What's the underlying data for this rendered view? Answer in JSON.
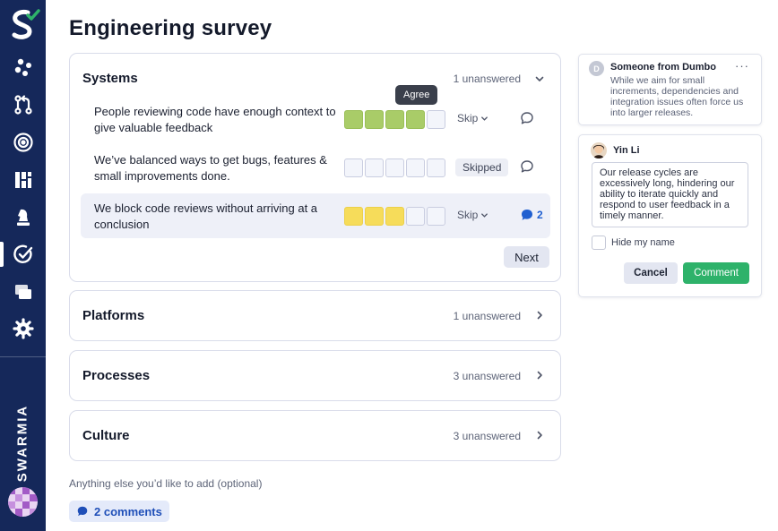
{
  "page": {
    "title": "Engineering survey"
  },
  "sidebar": {
    "brand": "SWARMIA",
    "items": [
      {
        "icon": "cluster-icon"
      },
      {
        "icon": "pull-request-icon"
      },
      {
        "icon": "target-icon"
      },
      {
        "icon": "dashboard-icon"
      },
      {
        "icon": "chess-piece-icon"
      },
      {
        "icon": "survey-check-icon",
        "active": true
      },
      {
        "icon": "layers-icon"
      },
      {
        "icon": "gear-icon"
      }
    ]
  },
  "survey": {
    "sections": [
      {
        "title": "Systems",
        "count": "1 unanswered",
        "expanded": true,
        "questions": [
          {
            "text": "People reviewing code have enough context to give valuable feedback",
            "rating": 4,
            "color": "green",
            "action": "Skip"
          },
          {
            "text": "We’ve balanced ways to get bugs, features & small improvements done.",
            "rating": 0,
            "action": "Skipped"
          },
          {
            "text": "We block code reviews without arriving at a conclusion",
            "rating": 3,
            "color": "yellow",
            "action": "Skip",
            "comments": "2"
          }
        ],
        "tooltip": "Agree",
        "next_label": "Next"
      },
      {
        "title": "Platforms",
        "count": "1 unanswered"
      },
      {
        "title": "Processes",
        "count": "3 unanswered"
      },
      {
        "title": "Culture",
        "count": "3 unanswered"
      }
    ],
    "optional_label": "Anything else you’d like to add (optional)",
    "comments_label": "2 comments"
  },
  "comments_panel": {
    "existing": {
      "avatar_letter": "D",
      "author": "Someone from Dumbo",
      "more": "···",
      "text": "While we aim for small increments, dependencies and integration issues often force us into larger releases."
    },
    "draft": {
      "author": "Yin Li",
      "text": "Our release cycles are excessively long, hindering our ability to iterate quickly and respond to user feedback in a timely manner.",
      "hide_name_label": "Hide my name",
      "hide_name_checked": false,
      "cancel_label": "Cancel",
      "submit_label": "Comment"
    }
  },
  "colors": {
    "sidebar": "#15285a",
    "accent_green": "#2eb26a",
    "rating_green": "#a9cc68",
    "rating_yellow": "#f6dc5a",
    "link_blue": "#1f5fd0"
  }
}
